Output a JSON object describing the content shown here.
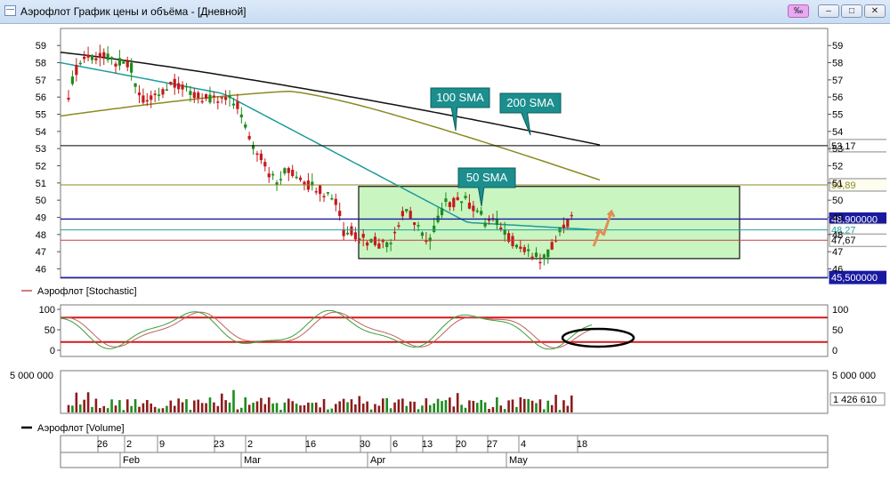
{
  "window": {
    "title": "Аэрофлот График цены и объёма - [Дневной]",
    "buttons": [
      "‰",
      "–",
      "□",
      "✕"
    ]
  },
  "price_panel": {
    "y_ticks": [
      46,
      47,
      48,
      49,
      50,
      51,
      52,
      53,
      54,
      55,
      56,
      57,
      58,
      59
    ],
    "levels": [
      {
        "label": "53,17",
        "value": 53.17,
        "color": "#000000"
      },
      {
        "label": "50,89",
        "value": 50.89,
        "color": "#8a8a2a"
      },
      {
        "label": "48,900000",
        "value": 48.9,
        "color": "#1a1aa0"
      },
      {
        "label": "48,27",
        "value": 48.27,
        "color": "#20a0a0"
      },
      {
        "label": "47,67",
        "value": 47.67,
        "color": "#c04040"
      },
      {
        "label": "45,500000",
        "value": 45.5,
        "color": "#1a1aa0"
      }
    ],
    "annotations": [
      "100 SMA",
      "200 SMA",
      "50 SMA"
    ]
  },
  "stochastic_panel": {
    "legend": "Аэрофлот [Stochastic]",
    "y_ticks": [
      "100",
      "50",
      "0"
    ],
    "overbought": 80,
    "oversold": 20
  },
  "volume_panel": {
    "legend": "Аэрофлот [Volume]",
    "top_label": "5 000 000",
    "last_value_label": "1 426 610"
  },
  "x_axis": {
    "day_ticks": [
      "26",
      "2",
      "9",
      "23",
      "2",
      "16",
      "30",
      "6",
      "13",
      "20",
      "27",
      "4",
      "18"
    ],
    "month_labels": [
      "Feb",
      "Mar",
      "Apr",
      "May"
    ]
  },
  "colors": {
    "up": "#1d8c1d",
    "down": "#c41a1a",
    "sma50": "#1f9b9b",
    "sma100": "#8b8b22",
    "sma200": "#111111",
    "callout": "#1c8e8e",
    "zone": "#c9f5c1"
  },
  "chart_data": [
    {
      "type": "candlestick",
      "title": "Аэрофлот",
      "ylim": [
        45.4,
        59.4
      ],
      "series": [
        {
          "name": "50 SMA",
          "values_summary": "descending from ~58 to ~48.3"
        },
        {
          "name": "100 SMA",
          "values_summary": "~55 rising to ~56.4 then descending to ~50.9"
        },
        {
          "name": "200 SMA",
          "values_summary": "~58.6 descending to ~53.2"
        }
      ]
    },
    {
      "type": "line",
      "title": "Аэрофлот [Stochastic]",
      "ylim": [
        0,
        100
      ]
    },
    {
      "type": "bar",
      "title": "Аэрофлот [Volume]",
      "ylim": [
        0,
        5000000
      ]
    }
  ]
}
